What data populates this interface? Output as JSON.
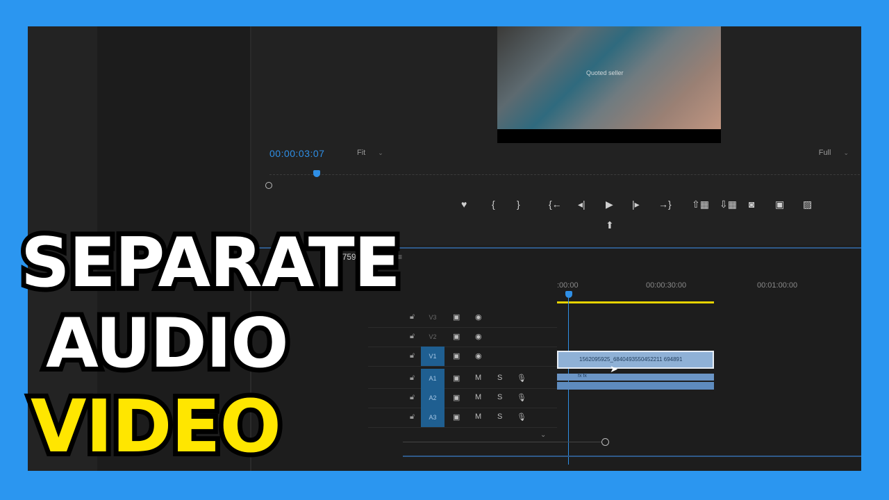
{
  "colors": {
    "border": "#2b96f0",
    "accent": "#2f8fe6",
    "workarea": "#e6d200",
    "headline_highlight": "#ffe600"
  },
  "program_monitor": {
    "timecode": "00:00:03:07",
    "zoom_label": "Fit",
    "resolution_label": "Full",
    "video_caption": "Quoted seller",
    "transport_icons": [
      "add-marker-icon",
      "mark-in-icon",
      "mark-out-icon",
      "go-to-in-icon",
      "step-back-icon",
      "play-icon",
      "step-forward-icon",
      "go-to-out-icon",
      "lift-icon",
      "extract-icon",
      "export-frame-icon",
      "comparison-view-icon",
      "proxy-toggle-icon",
      "export-icon"
    ]
  },
  "timeline": {
    "sequence_name": "#1557592456356​9",
    "ruler_labels": [
      ":00:00",
      "00:00:30:00",
      "00:01:00:00"
    ],
    "tracks": [
      {
        "label": "V3",
        "type": "video",
        "targeted": false
      },
      {
        "label": "V2",
        "type": "video",
        "targeted": false
      },
      {
        "label": "V1",
        "type": "video",
        "targeted": true
      },
      {
        "label": "A1",
        "type": "audio",
        "targeted": true
      },
      {
        "label": "A2",
        "type": "audio",
        "targeted": true
      },
      {
        "label": "A3",
        "type": "audio",
        "targeted": true
      }
    ],
    "mute_label": "M",
    "solo_label": "S",
    "video_clip_label": "1562095925_6840493550452211 694891",
    "audio_clip_label": "fx fx"
  },
  "headline": {
    "line1": "SEPARATE",
    "line2": "AUDIO",
    "line3": "VIDEO"
  }
}
